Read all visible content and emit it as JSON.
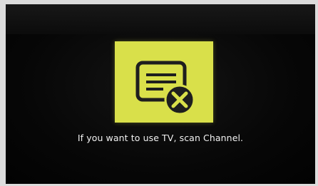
{
  "dialog": {
    "icon_name": "no-channel-icon",
    "message": "If you want to use TV, scan Channel.",
    "colors": {
      "icon_background": "#d9e04a",
      "icon_foreground": "#1e1e1e",
      "screen_background": "#050505",
      "text": "#f2f2f2"
    }
  }
}
